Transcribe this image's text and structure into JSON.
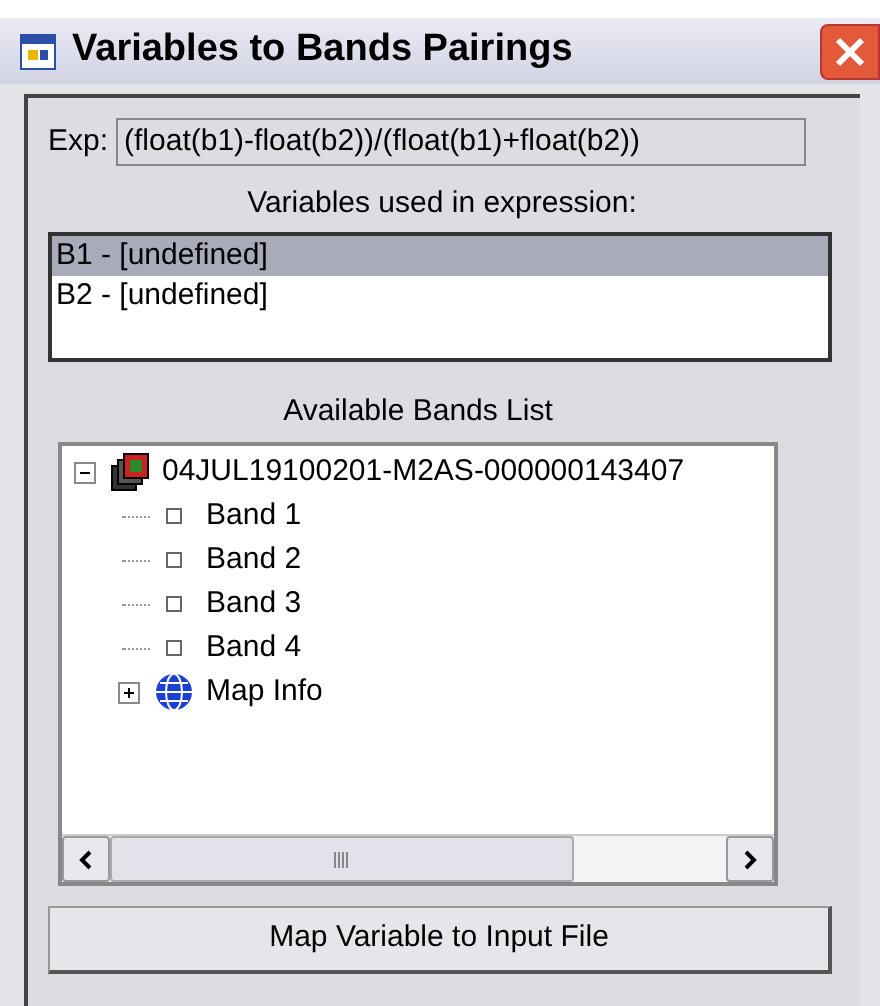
{
  "window": {
    "title": "Variables to Bands Pairings"
  },
  "expression": {
    "label": "Exp:",
    "value": "(float(b1)-float(b2))/(float(b1)+float(b2))"
  },
  "variables": {
    "label": "Variables used in expression:",
    "items": [
      {
        "text": "B1 - [undefined]",
        "selected": true
      },
      {
        "text": "B2 - [undefined]",
        "selected": false
      }
    ]
  },
  "bands": {
    "label": "Available Bands List",
    "tree": [
      {
        "text": "04JUL19100201-M2AS-000000143407",
        "kind": "dataset",
        "expanded": true,
        "children": [
          {
            "text": "Band 1",
            "kind": "band"
          },
          {
            "text": "Band 2",
            "kind": "band"
          },
          {
            "text": "Band 3",
            "kind": "band"
          },
          {
            "text": "Band 4",
            "kind": "band"
          },
          {
            "text": "Map Info",
            "kind": "mapinfo",
            "expanded": false
          }
        ]
      }
    ]
  },
  "button": "Map Variable to Input File"
}
